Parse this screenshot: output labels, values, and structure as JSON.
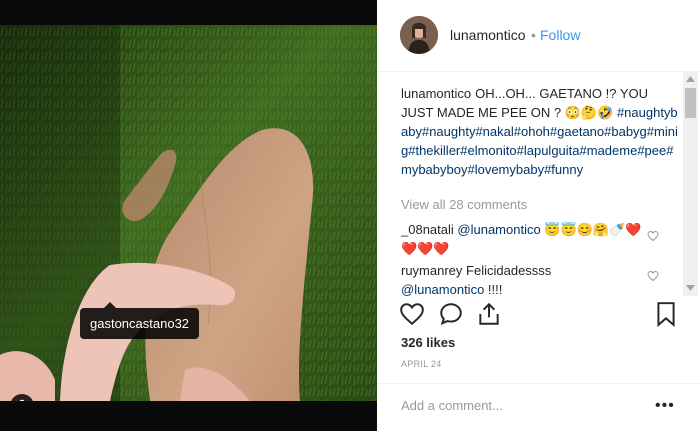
{
  "post": {
    "user_tag": "gastoncastano32",
    "tags_icon": "user-tags-icon"
  },
  "header": {
    "username": "lunamontico",
    "separator": "•",
    "follow_label": "Follow"
  },
  "caption": {
    "username": "lunamontico",
    "text": "OH...OH... GAETANO !? YOU JUST MADE ME PEE ON ? 😳🤔🤣",
    "hashtags": "#naughtybaby#naughty#nakal#ohoh#gaetano#babyg#minig#thekiller#elmonito#lapulguita#mademe#pee#mybabyboy#lovemybaby#funny"
  },
  "view_all_comments": "View all 28 comments",
  "comments": [
    {
      "username": "_08natali",
      "mention": "@lunamontico",
      "text": "😇😇😊🤗🍼❤️❤️❤️❤️"
    },
    {
      "username": "ruymanrey",
      "text": "Felicidadessss",
      "mention": "@lunamontico",
      "suffix": "!!!!"
    }
  ],
  "likes": "326 likes",
  "date": "APRIL 24",
  "add_comment": {
    "placeholder": "Add a comment...",
    "more_label": "•••"
  },
  "colors": {
    "link": "#003569",
    "follow": "#3897f0",
    "muted": "#999999",
    "text": "#262626"
  }
}
